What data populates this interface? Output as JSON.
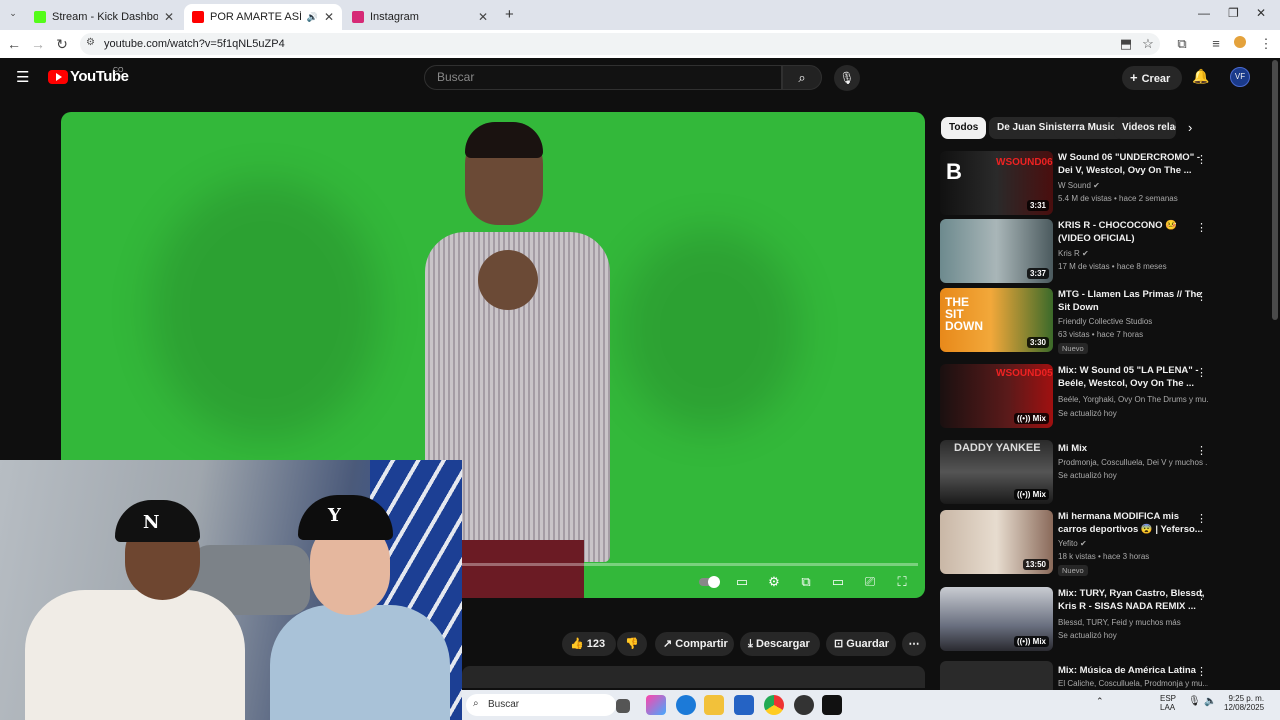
{
  "browser": {
    "tabs": [
      {
        "title": "Stream - Kick Dashboard",
        "color": "#53fc18"
      },
      {
        "title": "POR AMARTE ASÍ - Juan Sin",
        "color": "#ff0000"
      },
      {
        "title": "Instagram",
        "color": "#d62976"
      }
    ],
    "url": "youtube.com/watch?v=5f1qNL5uZP4"
  },
  "youtube": {
    "logo": "YouTube",
    "logo_suffix": "CO",
    "search_placeholder": "Buscar",
    "create_label": "Crear",
    "avatar_text": "VF"
  },
  "actions": {
    "likes": "123",
    "share": "Compartir",
    "download": "Descargar",
    "save": "Guardar"
  },
  "sidebar": {
    "chips": [
      "Todos",
      "De Juan Sinisterra Music",
      "Videos relac"
    ],
    "videos": [
      {
        "title": "W Sound 06 \"UNDERCROMO\" - Dei V, Westcol, Ovy On The ...",
        "channel": "W Sound ✔",
        "meta": "5.4 M de vistas • hace 2 semanas",
        "badge": "3:31",
        "nuevo": ""
      },
      {
        "title": "KRIS R - CHOCOCONO 🤒 (VIDEO OFICIAL)",
        "channel": "Kris R ✔",
        "meta": "17 M de vistas • hace 8 meses",
        "badge": "3:37",
        "nuevo": ""
      },
      {
        "title": "MTG - Llamen Las Primas // The Sit Down",
        "channel": "Friendly Collective Studios",
        "meta": "63 vistas • hace 7 horas",
        "badge": "3:30",
        "nuevo": "Nuevo"
      },
      {
        "title": "Mix: W Sound 05 \"LA PLENA\" - Beéle, Westcol, Ovy On The ...",
        "channel": "Beéle, Yorghaki, Ovy On The Drums y mu...",
        "meta": "Se actualizó hoy",
        "badge": "Mix",
        "nuevo": ""
      },
      {
        "title": "Mi Mix",
        "channel": "Prodmonja, Cosculluela, Dei V y muchos ...",
        "meta": "Se actualizó hoy",
        "badge": "Mix",
        "nuevo": ""
      },
      {
        "title": "Mi hermana MODIFICA mis carros deportivos 😨 | Yeferso...",
        "channel": "Yefito ✔",
        "meta": "18 k vistas • hace 3 horas",
        "badge": "13:50",
        "nuevo": "Nuevo"
      },
      {
        "title": "Mix: TURY, Ryan Castro, Blessd, Kris R - SISAS NADA REMIX ...",
        "channel": "Blessd, TURY, Feid y muchos más",
        "meta": "Se actualizó hoy",
        "badge": "Mix",
        "nuevo": ""
      },
      {
        "title": "Mix: Música de América Latina",
        "channel": "El Caliche, Cosculluela, Prodmonja y mu...",
        "meta": "",
        "badge": "",
        "nuevo": ""
      }
    ]
  },
  "taskbar": {
    "search_placeholder": "Buscar",
    "lang": "ESP",
    "lang2": "LAA",
    "time": "9:25 p. m.",
    "date": "12/08/2025"
  }
}
